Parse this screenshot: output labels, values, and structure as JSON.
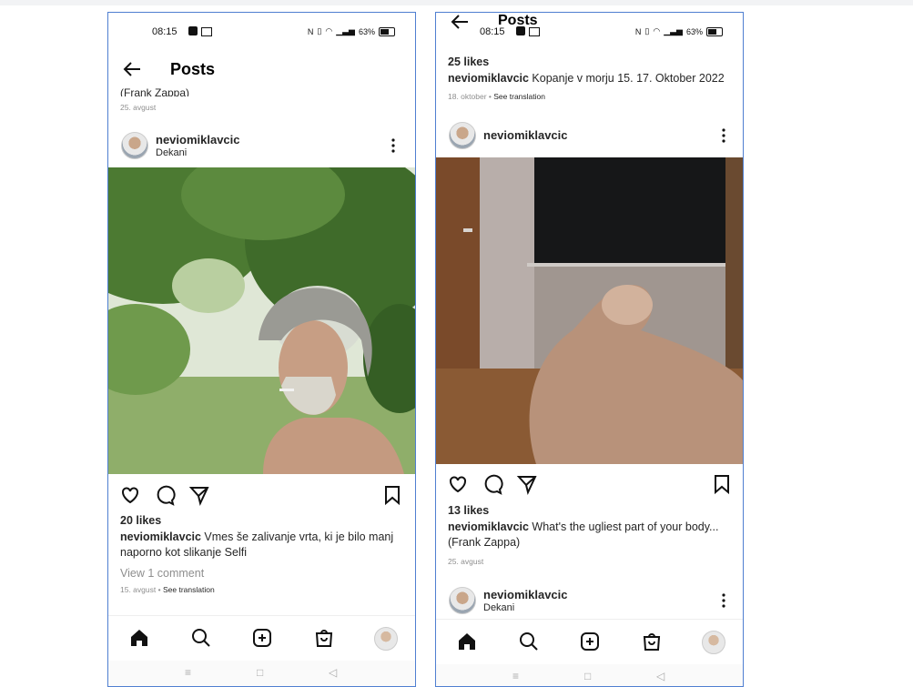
{
  "phone1": {
    "status": {
      "time": "08:15",
      "battery": "63%"
    },
    "header": {
      "title": "Posts"
    },
    "prev": {
      "caption_tail": "(Frank Zappa)",
      "date": "25. avgust"
    },
    "post": {
      "username": "neviomiklavcic",
      "location": "Dekani",
      "likes": "20 likes",
      "caption_user": "neviomiklavcic",
      "caption_text": " Vmes še zalivanje vrta, ki je bilo manj naporno kot slikanje Selfi",
      "view_comments": "View 1 comment",
      "date": "15. avgust",
      "translate": "See translation"
    }
  },
  "phone2": {
    "status": {
      "time": "08:15",
      "battery": "63%"
    },
    "header": {
      "title": "Posts"
    },
    "prev": {
      "likes": "25 likes",
      "caption_user": "neviomiklavcic",
      "caption_text": " Kopanje v morju 15. 17. Oktober 2022",
      "date": "18. oktober",
      "translate": "See translation"
    },
    "post": {
      "username": "neviomiklavcic",
      "likes": "13 likes",
      "caption_user": "neviomiklavcic",
      "caption_text": " What's the ugliest part of your body... (Frank Zappa)",
      "date": "25. avgust"
    },
    "next": {
      "username": "neviomiklavcic",
      "location": "Dekani"
    }
  },
  "separator": "•",
  "icons": [
    "back-arrow-icon",
    "heart-icon",
    "comment-icon",
    "share-icon",
    "bookmark-icon",
    "more-icon",
    "home-icon",
    "search-icon",
    "add-icon",
    "shop-icon"
  ]
}
